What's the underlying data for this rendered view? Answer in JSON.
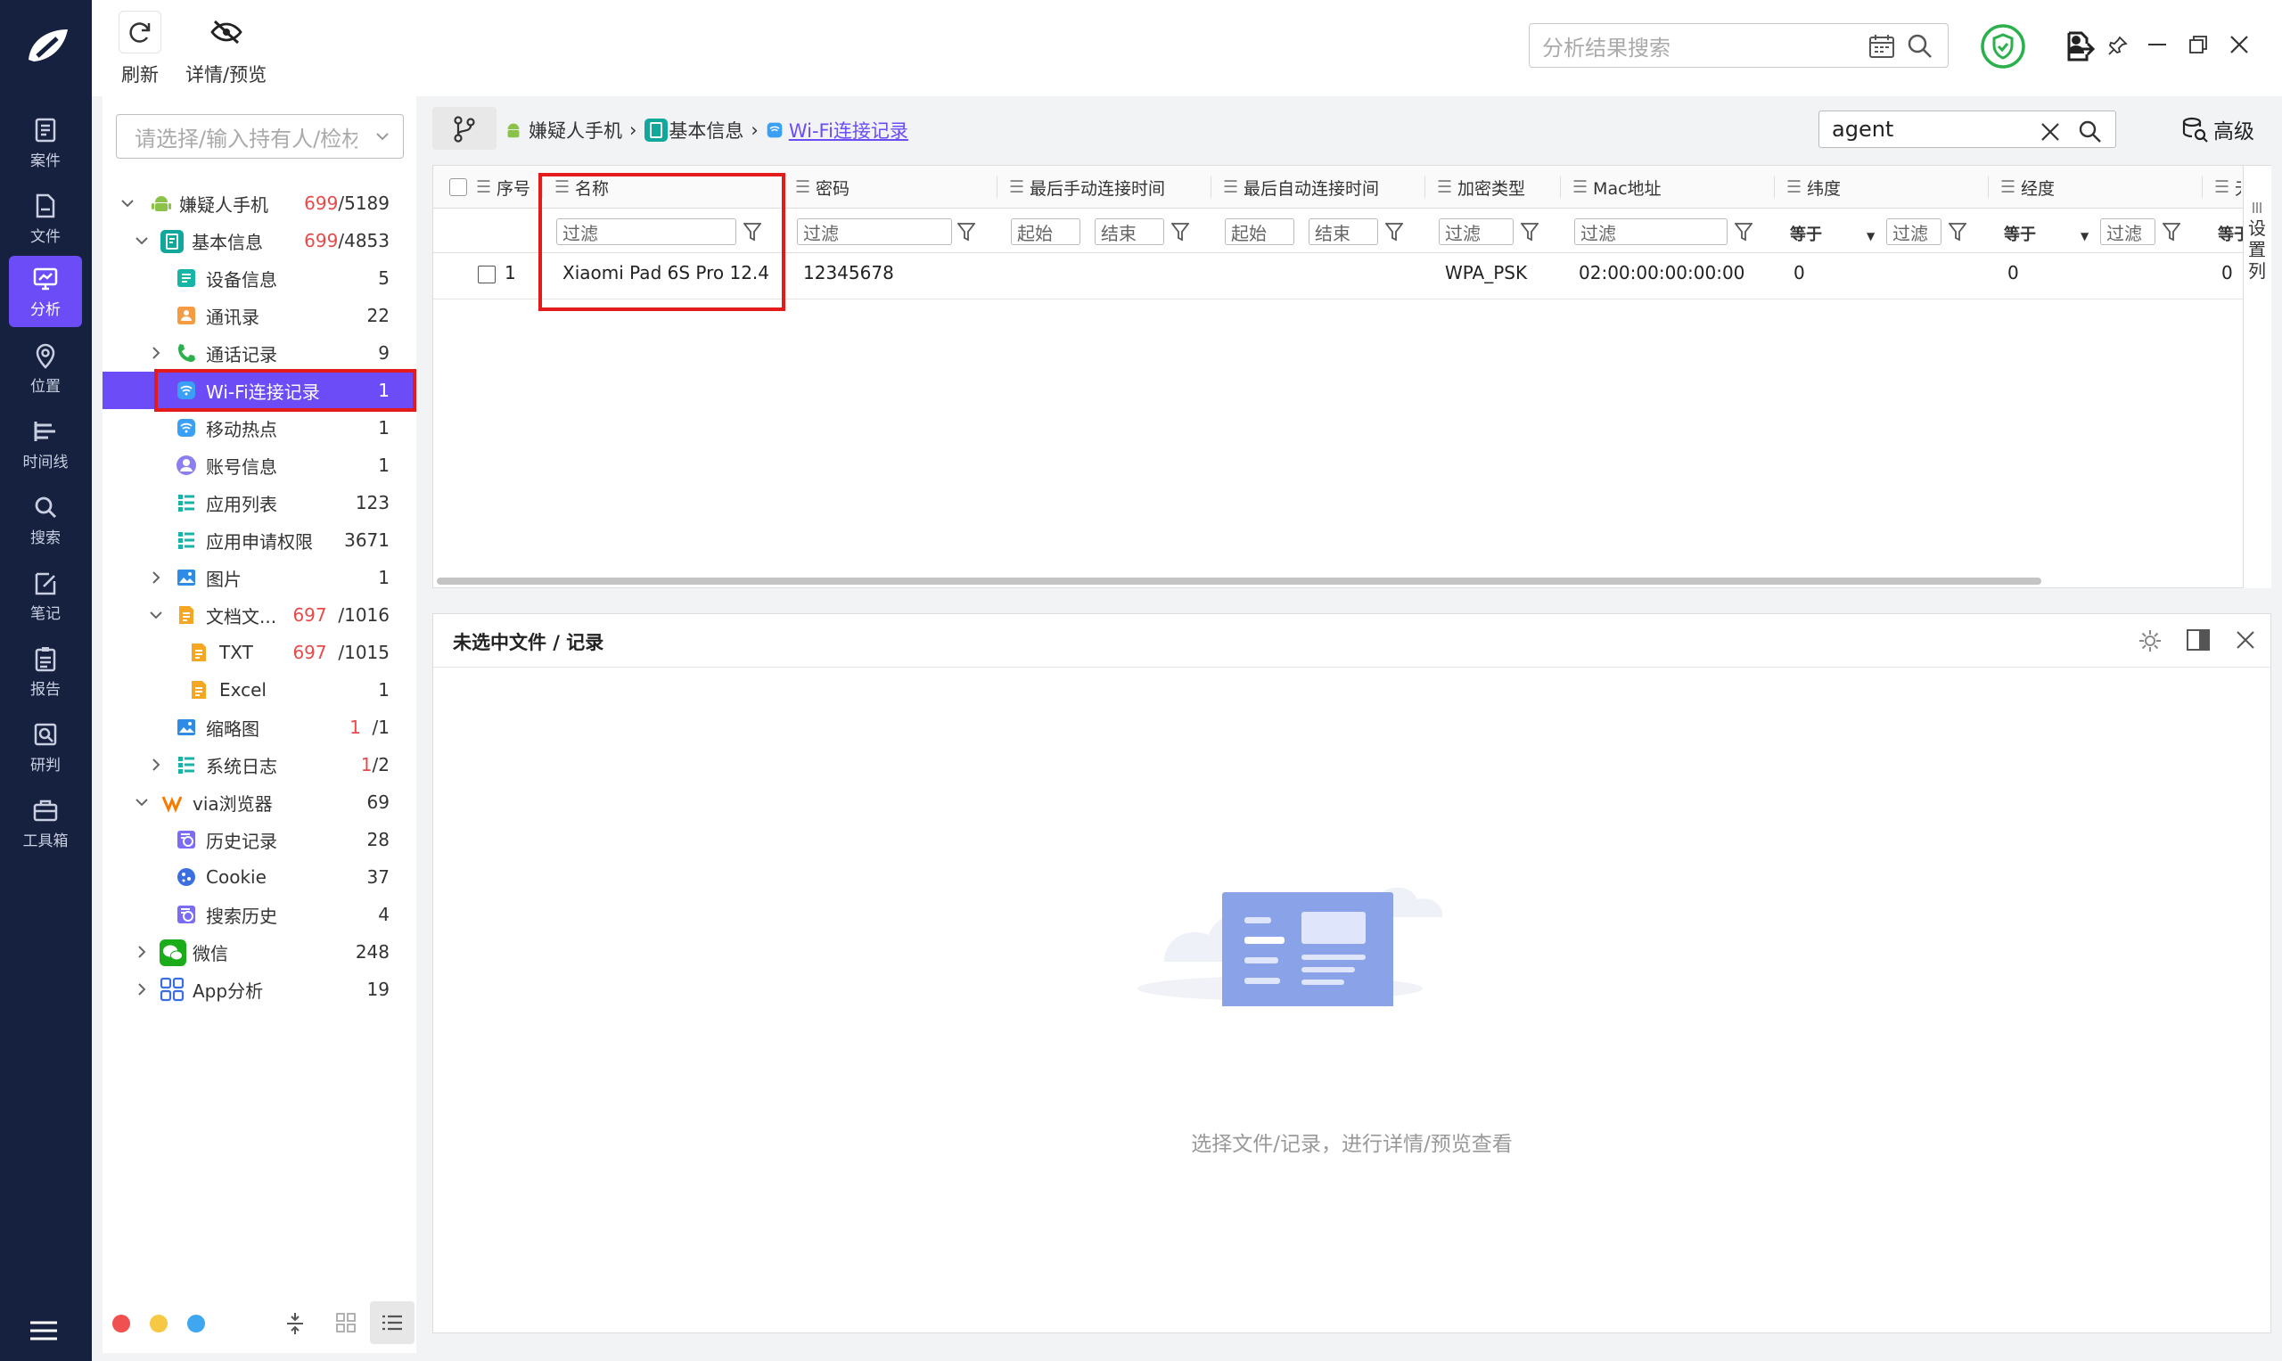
{
  "nav": {
    "items": [
      {
        "label": "案件",
        "icon": "case-icon"
      },
      {
        "label": "文件",
        "icon": "file-icon"
      },
      {
        "label": "分析",
        "icon": "analysis-icon",
        "active": true
      },
      {
        "label": "位置",
        "icon": "location-icon"
      },
      {
        "label": "时间线",
        "icon": "timeline-icon"
      },
      {
        "label": "搜索",
        "icon": "search-icon"
      },
      {
        "label": "笔记",
        "icon": "note-icon"
      },
      {
        "label": "报告",
        "icon": "report-icon"
      },
      {
        "label": "研判",
        "icon": "judge-icon"
      },
      {
        "label": "工具箱",
        "icon": "toolbox-icon"
      }
    ]
  },
  "toolbar": {
    "refresh_label": "刷新",
    "detail_label": "详情/预览",
    "search_placeholder": "分析结果搜索"
  },
  "tree": {
    "search_placeholder": "请选择/输入持有人/检材",
    "items": [
      {
        "label": "嫌疑人手机",
        "count_red": "699",
        "count": "/5189",
        "icon": "android-icon"
      },
      {
        "label": "基本信息",
        "count_red": "699",
        "count": "/4853",
        "icon": "basic-info-icon"
      },
      {
        "label": "设备信息",
        "count": "5",
        "icon": "device-info-icon"
      },
      {
        "label": "通讯录",
        "count": "22",
        "icon": "contacts-icon"
      },
      {
        "label": "通话记录",
        "count": "9",
        "icon": "phone-icon"
      },
      {
        "label": "Wi-Fi连接记录",
        "count": "1",
        "icon": "wifi-icon",
        "selected": true
      },
      {
        "label": "移动热点",
        "count": "1",
        "icon": "hotspot-icon"
      },
      {
        "label": "账号信息",
        "count": "1",
        "icon": "account-icon"
      },
      {
        "label": "应用列表",
        "count": "123",
        "icon": "app-list-icon"
      },
      {
        "label": "应用申请权限",
        "count": "3671",
        "icon": "permission-icon"
      },
      {
        "label": "图片",
        "count": "1",
        "icon": "image-icon"
      },
      {
        "label": "文档文...",
        "count_red": "697",
        "count": "/1016",
        "icon": "document-icon"
      },
      {
        "label": "TXT",
        "count_red": "697",
        "count": "/1015",
        "icon": "txt-icon"
      },
      {
        "label": "Excel",
        "count": "1",
        "icon": "excel-icon"
      },
      {
        "label": "缩略图",
        "count_red": "1",
        "count": "/1",
        "icon": "thumbnail-icon"
      },
      {
        "label": "系统日志",
        "count_red": "1",
        "count": "/2",
        "icon": "syslog-icon"
      },
      {
        "label": "via浏览器",
        "count": "69",
        "icon": "via-browser-icon"
      },
      {
        "label": "历史记录",
        "count": "28",
        "icon": "history-icon"
      },
      {
        "label": "Cookie",
        "count": "37",
        "icon": "cookie-icon"
      },
      {
        "label": "搜索历史",
        "count": "4",
        "icon": "search-history-icon"
      },
      {
        "label": "微信",
        "count": "248",
        "icon": "wechat-icon"
      },
      {
        "label": "App分析",
        "count": "19",
        "icon": "app-analysis-icon"
      }
    ]
  },
  "breadcrumb": {
    "items": [
      "嫌疑人手机",
      "基本信息",
      "Wi-Fi连接记录"
    ]
  },
  "grid_search": {
    "value": "agent",
    "advanced_label": "高级"
  },
  "grid": {
    "columns": [
      "序号",
      "名称",
      "密码",
      "最后手动连接时间",
      "最后自动连接时间",
      "加密类型",
      "Mac地址",
      "纬度",
      "经度",
      "无"
    ],
    "filter_placeholder": "过滤",
    "start_label": "起始",
    "end_label": "结束",
    "equals_label": "等于",
    "side_label": "设置列",
    "rows": [
      {
        "index": "1",
        "name": "Xiaomi Pad 6S Pro 12.4",
        "password": "12345678",
        "manual_time": "",
        "auto_time": "",
        "encryption": "WPA_PSK",
        "mac": "02:00:00:00:00:00",
        "lat": "0",
        "lng": "0",
        "extra": "0"
      }
    ]
  },
  "detail": {
    "title": "未选中文件 / 记录",
    "empty_text": "选择文件/记录，进行详情/预览查看"
  },
  "colors": {
    "nav_bg": "#16213f",
    "accent": "#6b4cf6",
    "highlight": "#e31b1b"
  }
}
